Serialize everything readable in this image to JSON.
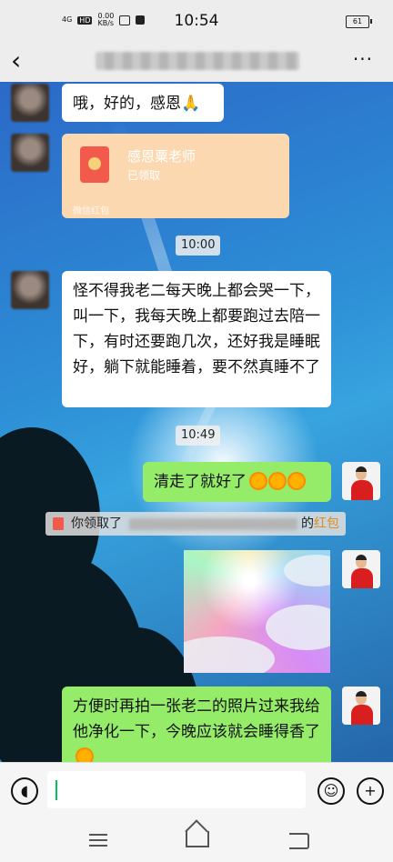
{
  "status_bar": {
    "network": "4G",
    "hd": "HD",
    "speed": "0.00",
    "speed_unit": "KB/s",
    "time": "10:54",
    "battery": "61"
  },
  "header": {
    "back_glyph": "‹",
    "more_glyph": "···"
  },
  "messages": {
    "m1": {
      "text": "哦，好的，感恩",
      "emoji": "🙏"
    },
    "red_packet": {
      "title": "感恩粟老师",
      "status": "已领取",
      "footer": "微信红包"
    },
    "ts1": "10:00",
    "m2": {
      "text": "怪不得我老二每天晚上都会哭一下，叫一下，我每天晚上都要跑过去陪一下，有时还要跑几次，还好我是睡眠好，躺下就能睡着，要不然真睡不了"
    },
    "ts2": "10:49",
    "m3": {
      "text": "清走了就好了"
    },
    "system_note": {
      "prefix": "你领取了",
      "suffix": "的",
      "link": "红包"
    },
    "m5": {
      "text": "方便时再拍一张老二的照片过来我给他净化一下，今晚应该就会睡得香了"
    }
  },
  "colors": {
    "green_bubble": "#95ec69",
    "red_packet": "#fbd8b0",
    "link": "#e28a1c"
  }
}
